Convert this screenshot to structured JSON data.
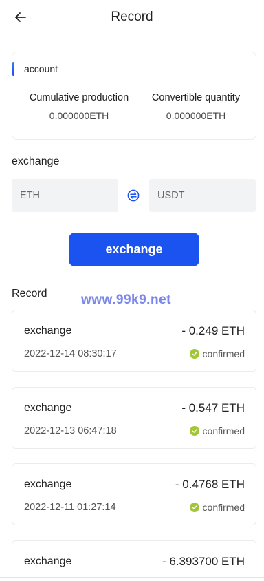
{
  "header": {
    "title": "Record"
  },
  "account": {
    "label": "account",
    "cumulative_label": "Cumulative production",
    "cumulative_value": "0.000000ETH",
    "convertible_label": "Convertible quantity",
    "convertible_value": "0.000000ETH"
  },
  "exchange": {
    "section_label": "exchange",
    "from_placeholder": "ETH",
    "to_placeholder": "USDT",
    "button_label": "exchange"
  },
  "watermark": "www.99k9.net",
  "records_section": {
    "label": "Record",
    "items": [
      {
        "type": "exchange",
        "amount": "- 0.249 ETH",
        "date": "2022-12-14 08:30:17",
        "status": "confirmed"
      },
      {
        "type": "exchange",
        "amount": "- 0.547 ETH",
        "date": "2022-12-13 06:47:18",
        "status": "confirmed"
      },
      {
        "type": "exchange",
        "amount": "- 0.4768 ETH",
        "date": "2022-12-11 01:27:14",
        "status": "confirmed"
      },
      {
        "type": "exchange",
        "amount": "- 6.393700 ETH",
        "date": "",
        "status": ""
      }
    ]
  },
  "colors": {
    "accent": "#1a53f0",
    "confirmed": "#a3c639",
    "field_bg": "#f2f3f5"
  },
  "icons": {
    "back": "arrow-left-icon",
    "swap": "swap-icon",
    "confirmed": "check-circle-icon"
  }
}
